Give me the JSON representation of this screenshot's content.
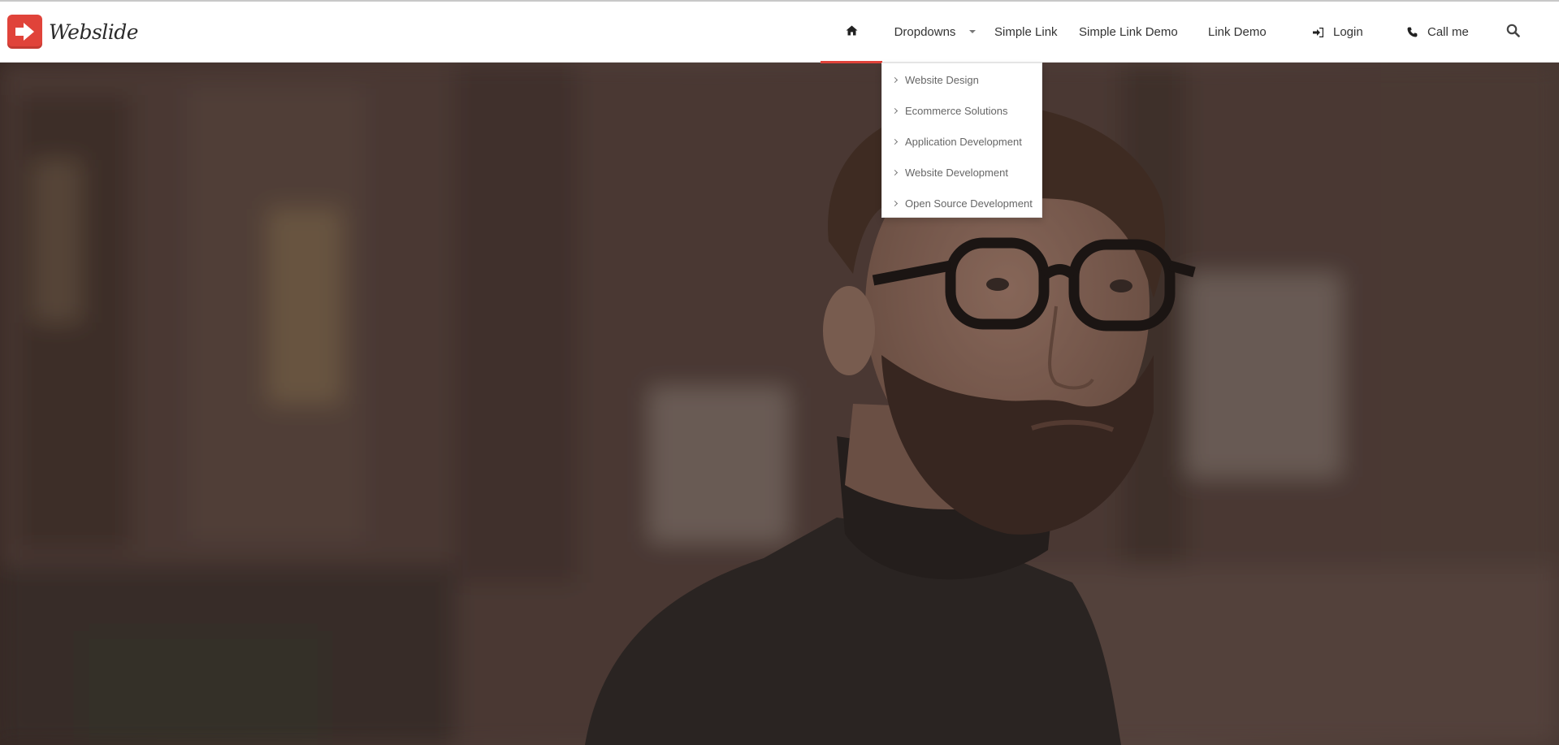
{
  "brand": {
    "name": "Webslide",
    "accent": "#e0433a"
  },
  "nav": {
    "home_icon": "home-icon",
    "items": [
      {
        "label": "Dropdowns"
      },
      {
        "label": "Simple Link"
      },
      {
        "label": "Simple Link Demo"
      },
      {
        "label": "Link Demo"
      },
      {
        "label": "Login",
        "icon": "sign-in-icon"
      },
      {
        "label": "Call me",
        "icon": "phone-icon"
      }
    ],
    "search_icon": "search-icon"
  },
  "dropdown": {
    "items": [
      {
        "label": "Website Design"
      },
      {
        "label": "Ecommerce Solutions"
      },
      {
        "label": "Application Development"
      },
      {
        "label": "Website Development"
      },
      {
        "label": "Open Source Development"
      }
    ]
  },
  "hero": {
    "image": "photo of a bearded man wearing glasses and a black turtleneck"
  }
}
